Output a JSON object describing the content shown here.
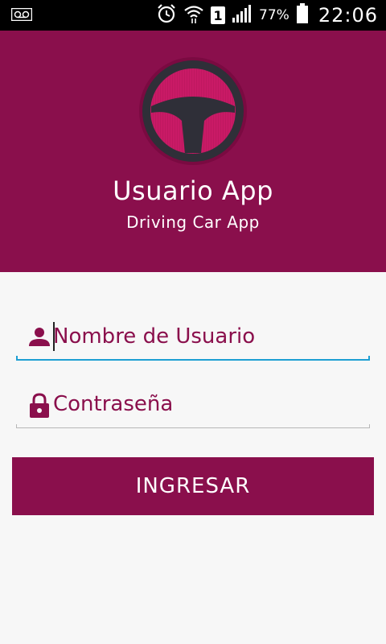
{
  "status_bar": {
    "battery_percent": "77%",
    "time": "22:06",
    "sim_slot": "1",
    "icons": [
      "voicemail-icon",
      "alarm-icon",
      "wifi-icon",
      "signal-icon",
      "battery-icon"
    ]
  },
  "header": {
    "title": "Usuario App",
    "subtitle": "Driving Car App",
    "logo_icon": "steering-wheel-icon"
  },
  "form": {
    "username_placeholder": "Nombre de Usuario",
    "password_placeholder": "Contraseña",
    "username_icon": "person-icon",
    "password_icon": "lock-icon",
    "submit_label": "INGRESAR"
  },
  "colors": {
    "primary": "#8a0f4c",
    "accent": "#1e9fd3",
    "background": "#f7f7f7"
  }
}
